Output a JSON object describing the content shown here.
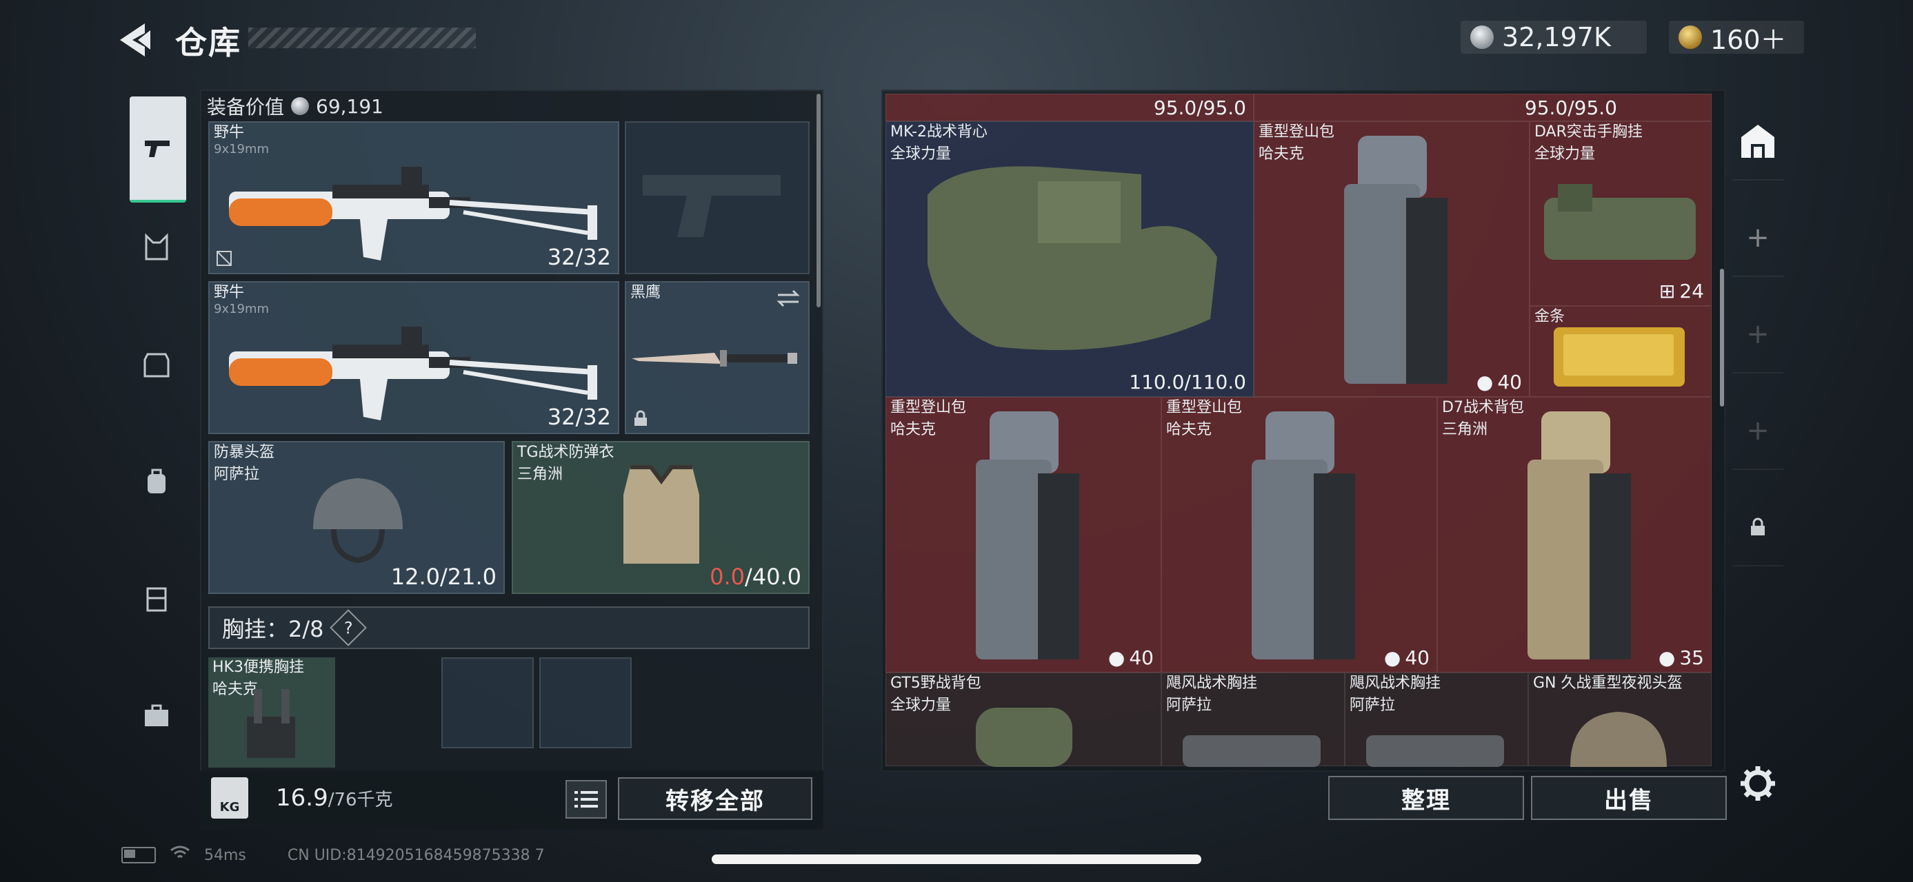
{
  "header": {
    "title": "仓库",
    "currencies": [
      {
        "icon": "silver-coin-icon",
        "value": "32,197K"
      },
      {
        "icon": "gold-coin-icon",
        "value": "160＋"
      }
    ]
  },
  "left": {
    "equip_value_label": "装备价值",
    "equip_value": "69,191",
    "primary1": {
      "name": "野牛",
      "caliber": "9x19mm",
      "ammo": "32/32"
    },
    "primary2": {
      "name": "野牛",
      "caliber": "9x19mm",
      "ammo": "32/32"
    },
    "melee": {
      "name": "黑鹰"
    },
    "helmet": {
      "name": "防暴头盔",
      "brand": "阿萨拉",
      "durability": "12.0/21.0"
    },
    "armor": {
      "name": "TG战术防弹衣",
      "brand": "三角洲",
      "dur_current": "0.0",
      "dur_max": "/40.0"
    },
    "chest_label": "胸挂：2/8",
    "chest_help": "?",
    "chest_item": {
      "name": "HK3便携胸挂",
      "brand": "哈夫克"
    },
    "weight_value": "16.9",
    "weight_max": "/76千克",
    "kg_label": "KG",
    "transfer_all": "转移全部"
  },
  "right": {
    "top_dur_left": "95.0/95.0",
    "top_dur_right": "95.0/95.0",
    "cells": [
      {
        "name": "MK-2战术背心",
        "brand": "全球力量",
        "value": "110.0/110.0"
      },
      {
        "name": "重型登山包",
        "brand": "哈夫克",
        "value": "40"
      },
      {
        "name": "DAR突击手胸挂",
        "brand": "全球力量",
        "value": "24"
      },
      {
        "name": "金条",
        "brand": "",
        "value": ""
      },
      {
        "name": "重型登山包",
        "brand": "哈夫克",
        "value": "40"
      },
      {
        "name": "重型登山包",
        "brand": "哈夫克",
        "value": "40"
      },
      {
        "name": "D7战术背包",
        "brand": "三角洲",
        "value": "35"
      },
      {
        "name": "GT5野战背包",
        "brand": "全球力量",
        "value": ""
      },
      {
        "name": "飓风战术胸挂",
        "brand": "阿萨拉",
        "value": ""
      },
      {
        "name": "飓风战术胸挂",
        "brand": "阿萨拉",
        "value": ""
      },
      {
        "name": "GN 久战重型夜视头盔",
        "brand": "",
        "value": ""
      }
    ],
    "tidy": "整理",
    "sell": "出售"
  },
  "status": {
    "ping": "54ms",
    "uid": "CN UID:8149205168459875338 7"
  },
  "colors": {
    "accent_green": "#37c891",
    "durability_red": "#e65a4d",
    "cell_red": "#762c30"
  }
}
